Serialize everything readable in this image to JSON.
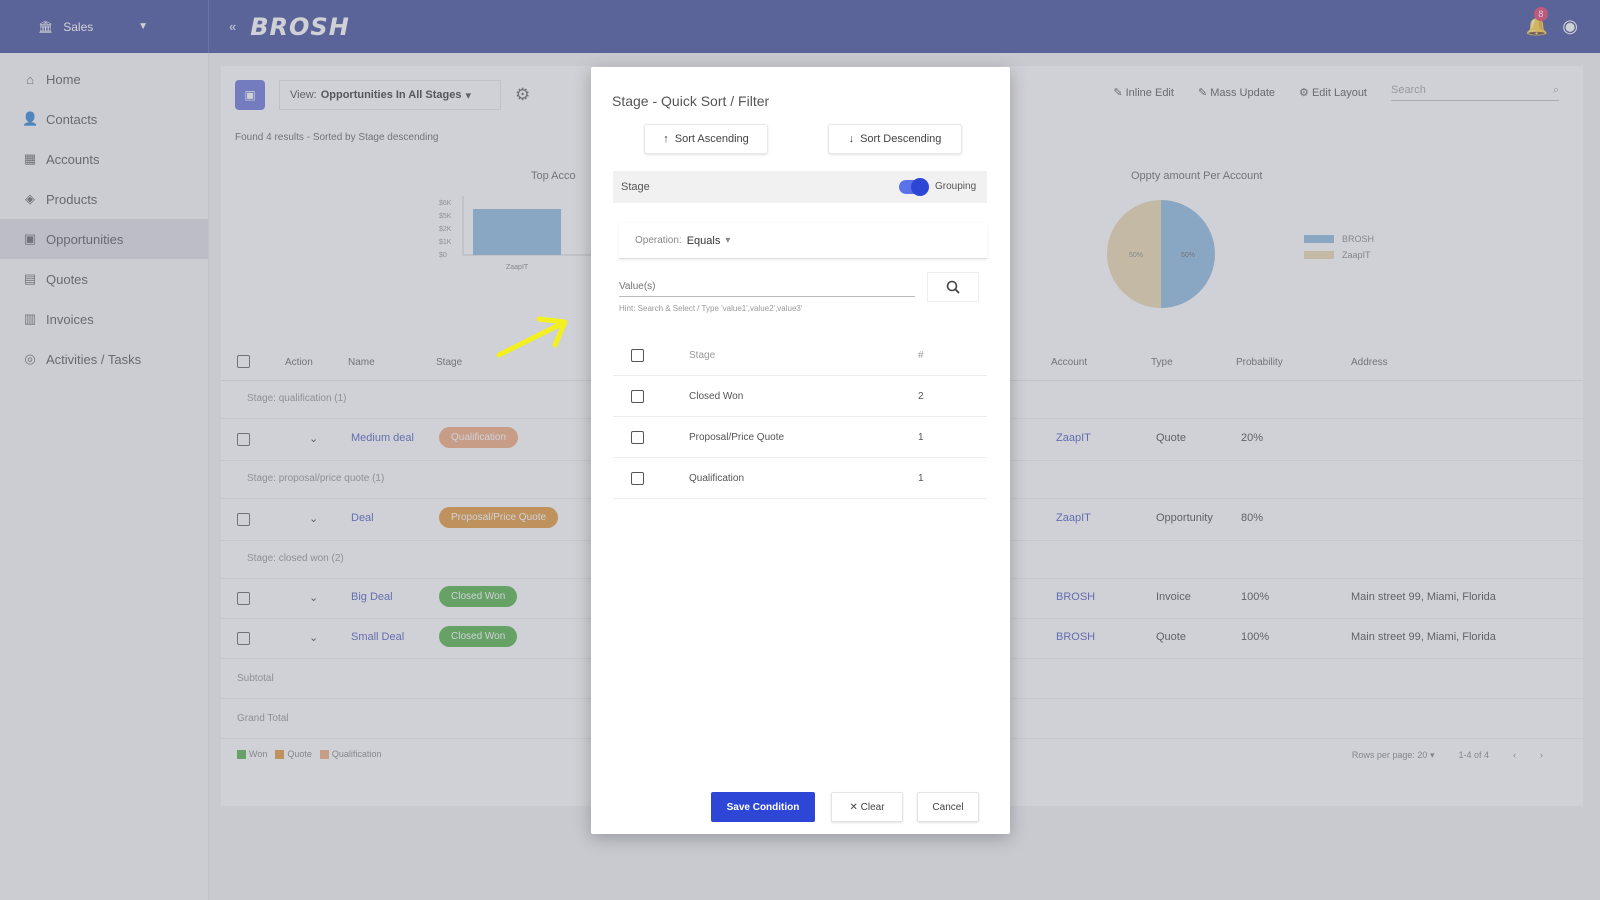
{
  "header": {
    "app_name": "Sales",
    "collapse": "«",
    "logo": "BROSH",
    "notifications": "8"
  },
  "sidebar": {
    "items": [
      {
        "label": "Home",
        "icon": "home-icon",
        "glyph": "⌂"
      },
      {
        "label": "Contacts",
        "icon": "person-icon",
        "glyph": "👤"
      },
      {
        "label": "Accounts",
        "icon": "building-icon",
        "glyph": "▦"
      },
      {
        "label": "Products",
        "icon": "box-icon",
        "glyph": "◈"
      },
      {
        "label": "Opportunities",
        "icon": "briefcase-icon",
        "glyph": "▣"
      },
      {
        "label": "Quotes",
        "icon": "document-icon",
        "glyph": "▤"
      },
      {
        "label": "Invoices",
        "icon": "invoice-icon",
        "glyph": "▥"
      },
      {
        "label": "Activities / Tasks",
        "icon": "check-circle-icon",
        "glyph": "◎"
      }
    ]
  },
  "toolbar": {
    "view_prefix": "View:",
    "view_value": "Opportunities In All Stages",
    "actions": [
      "Inline Edit",
      "Mass Update",
      "Edit Layout"
    ],
    "search_placeholder": "Search",
    "found_text": "Found 4 results - Sorted by Stage descending"
  },
  "charts": {
    "left_title": "Top Acco",
    "right_title": "Oppty amount Per Account",
    "y_ticks": [
      "$6K",
      "$5K",
      "$2K",
      "$1K",
      "$0"
    ],
    "bar_category": "ZaapIT",
    "pie_labels": [
      "50%",
      "50%"
    ],
    "legend": [
      "BROSH",
      "ZaapIT"
    ],
    "colors": {
      "blue": "#7fb2dc",
      "tan": "#e9d3a6"
    }
  },
  "table": {
    "columns_left": [
      "Action",
      "Name",
      "Stage"
    ],
    "columns_right": [
      "Account",
      "Type",
      "Probability",
      "Address"
    ],
    "groups": [
      "Stage: qualification (1)",
      "Stage: proposal/price quote (1)",
      "Stage: closed won (2)"
    ],
    "rows": [
      {
        "name": "Medium deal",
        "stage": "Qualification",
        "stage_color": "#f0a070",
        "account": "ZaapIT",
        "type": "Quote",
        "prob": "20%",
        "address": ""
      },
      {
        "name": "Deal",
        "stage": "Proposal/Price Quote",
        "stage_color": "#e08a22",
        "account": "ZaapIT",
        "type": "Opportunity",
        "prob": "80%",
        "address": ""
      },
      {
        "name": "Big Deal",
        "stage": "Closed Won",
        "stage_color": "#3ea832",
        "account": "BROSH",
        "type": "Invoice",
        "prob": "100%",
        "address": "Main street 99, Miami, Florida"
      },
      {
        "name": "Small Deal",
        "stage": "Closed Won",
        "stage_color": "#3ea832",
        "account": "BROSH",
        "type": "Quote",
        "prob": "100%",
        "address": "Main street 99, Miami, Florida"
      }
    ],
    "subtotal": "Subtotal",
    "grand_total": "Grand Total",
    "footer_legend": [
      "Won",
      "Quote",
      "Qualification"
    ],
    "rows_per_page_label": "Rows per page:",
    "rows_per_page": "20",
    "range": "1-4 of 4"
  },
  "dialog": {
    "title": "Stage - Quick Sort / Filter",
    "sort_ascending": "Sort Ascending",
    "sort_descending": "Sort Descending",
    "group_field": "Stage",
    "grouping_label": "Grouping",
    "grouping_on": true,
    "operation_label": "Operation:",
    "operation_value": "Equals",
    "value_placeholder": "Value(s)",
    "hint": "Hint: Search & Select / Type 'value1',value2',value3'",
    "list_header": {
      "label": "Stage",
      "count": "#"
    },
    "list": [
      {
        "label": "Closed Won",
        "count": "2"
      },
      {
        "label": "Proposal/Price Quote",
        "count": "1"
      },
      {
        "label": "Qualification",
        "count": "1"
      }
    ],
    "save": "Save Condition",
    "clear": "Clear",
    "cancel": "Cancel"
  }
}
